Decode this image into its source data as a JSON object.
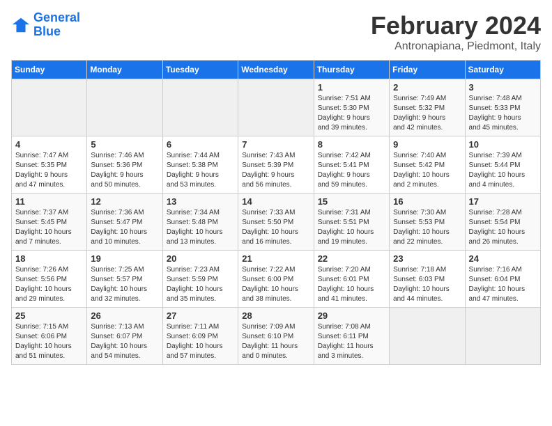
{
  "logo": {
    "line1": "General",
    "line2": "Blue"
  },
  "title": "February 2024",
  "subtitle": "Antronapiana, Piedmont, Italy",
  "days_of_week": [
    "Sunday",
    "Monday",
    "Tuesday",
    "Wednesday",
    "Thursday",
    "Friday",
    "Saturday"
  ],
  "weeks": [
    [
      {
        "day": "",
        "info": ""
      },
      {
        "day": "",
        "info": ""
      },
      {
        "day": "",
        "info": ""
      },
      {
        "day": "",
        "info": ""
      },
      {
        "day": "1",
        "info": "Sunrise: 7:51 AM\nSunset: 5:30 PM\nDaylight: 9 hours\nand 39 minutes."
      },
      {
        "day": "2",
        "info": "Sunrise: 7:49 AM\nSunset: 5:32 PM\nDaylight: 9 hours\nand 42 minutes."
      },
      {
        "day": "3",
        "info": "Sunrise: 7:48 AM\nSunset: 5:33 PM\nDaylight: 9 hours\nand 45 minutes."
      }
    ],
    [
      {
        "day": "4",
        "info": "Sunrise: 7:47 AM\nSunset: 5:35 PM\nDaylight: 9 hours\nand 47 minutes."
      },
      {
        "day": "5",
        "info": "Sunrise: 7:46 AM\nSunset: 5:36 PM\nDaylight: 9 hours\nand 50 minutes."
      },
      {
        "day": "6",
        "info": "Sunrise: 7:44 AM\nSunset: 5:38 PM\nDaylight: 9 hours\nand 53 minutes."
      },
      {
        "day": "7",
        "info": "Sunrise: 7:43 AM\nSunset: 5:39 PM\nDaylight: 9 hours\nand 56 minutes."
      },
      {
        "day": "8",
        "info": "Sunrise: 7:42 AM\nSunset: 5:41 PM\nDaylight: 9 hours\nand 59 minutes."
      },
      {
        "day": "9",
        "info": "Sunrise: 7:40 AM\nSunset: 5:42 PM\nDaylight: 10 hours\nand 2 minutes."
      },
      {
        "day": "10",
        "info": "Sunrise: 7:39 AM\nSunset: 5:44 PM\nDaylight: 10 hours\nand 4 minutes."
      }
    ],
    [
      {
        "day": "11",
        "info": "Sunrise: 7:37 AM\nSunset: 5:45 PM\nDaylight: 10 hours\nand 7 minutes."
      },
      {
        "day": "12",
        "info": "Sunrise: 7:36 AM\nSunset: 5:47 PM\nDaylight: 10 hours\nand 10 minutes."
      },
      {
        "day": "13",
        "info": "Sunrise: 7:34 AM\nSunset: 5:48 PM\nDaylight: 10 hours\nand 13 minutes."
      },
      {
        "day": "14",
        "info": "Sunrise: 7:33 AM\nSunset: 5:50 PM\nDaylight: 10 hours\nand 16 minutes."
      },
      {
        "day": "15",
        "info": "Sunrise: 7:31 AM\nSunset: 5:51 PM\nDaylight: 10 hours\nand 19 minutes."
      },
      {
        "day": "16",
        "info": "Sunrise: 7:30 AM\nSunset: 5:53 PM\nDaylight: 10 hours\nand 22 minutes."
      },
      {
        "day": "17",
        "info": "Sunrise: 7:28 AM\nSunset: 5:54 PM\nDaylight: 10 hours\nand 26 minutes."
      }
    ],
    [
      {
        "day": "18",
        "info": "Sunrise: 7:26 AM\nSunset: 5:56 PM\nDaylight: 10 hours\nand 29 minutes."
      },
      {
        "day": "19",
        "info": "Sunrise: 7:25 AM\nSunset: 5:57 PM\nDaylight: 10 hours\nand 32 minutes."
      },
      {
        "day": "20",
        "info": "Sunrise: 7:23 AM\nSunset: 5:59 PM\nDaylight: 10 hours\nand 35 minutes."
      },
      {
        "day": "21",
        "info": "Sunrise: 7:22 AM\nSunset: 6:00 PM\nDaylight: 10 hours\nand 38 minutes."
      },
      {
        "day": "22",
        "info": "Sunrise: 7:20 AM\nSunset: 6:01 PM\nDaylight: 10 hours\nand 41 minutes."
      },
      {
        "day": "23",
        "info": "Sunrise: 7:18 AM\nSunset: 6:03 PM\nDaylight: 10 hours\nand 44 minutes."
      },
      {
        "day": "24",
        "info": "Sunrise: 7:16 AM\nSunset: 6:04 PM\nDaylight: 10 hours\nand 47 minutes."
      }
    ],
    [
      {
        "day": "25",
        "info": "Sunrise: 7:15 AM\nSunset: 6:06 PM\nDaylight: 10 hours\nand 51 minutes."
      },
      {
        "day": "26",
        "info": "Sunrise: 7:13 AM\nSunset: 6:07 PM\nDaylight: 10 hours\nand 54 minutes."
      },
      {
        "day": "27",
        "info": "Sunrise: 7:11 AM\nSunset: 6:09 PM\nDaylight: 10 hours\nand 57 minutes."
      },
      {
        "day": "28",
        "info": "Sunrise: 7:09 AM\nSunset: 6:10 PM\nDaylight: 11 hours\nand 0 minutes."
      },
      {
        "day": "29",
        "info": "Sunrise: 7:08 AM\nSunset: 6:11 PM\nDaylight: 11 hours\nand 3 minutes."
      },
      {
        "day": "",
        "info": ""
      },
      {
        "day": "",
        "info": ""
      }
    ]
  ]
}
